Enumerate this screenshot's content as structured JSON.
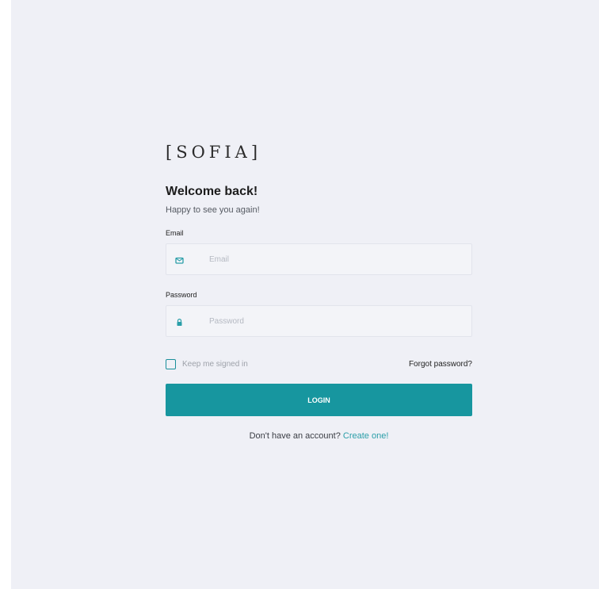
{
  "brand": {
    "logo_text": "[SOFIA]"
  },
  "login": {
    "title": "Welcome back!",
    "subtitle": "Happy to see you again!",
    "email": {
      "label": "Email",
      "placeholder": "Email",
      "value": "",
      "icon": "mail-icon"
    },
    "password": {
      "label": "Password",
      "placeholder": "Password",
      "value": "",
      "icon": "lock-icon"
    },
    "remember_label": "Keep me signed in",
    "remember_checked": false,
    "forgot_label": "Forgot password?",
    "submit_label": "LOGIN",
    "signup_prompt": "Don't have an account?",
    "signup_link": "Create one!"
  },
  "colors": {
    "accent": "#17969f",
    "background": "#eff0f6",
    "link": "#2a9ea8"
  }
}
